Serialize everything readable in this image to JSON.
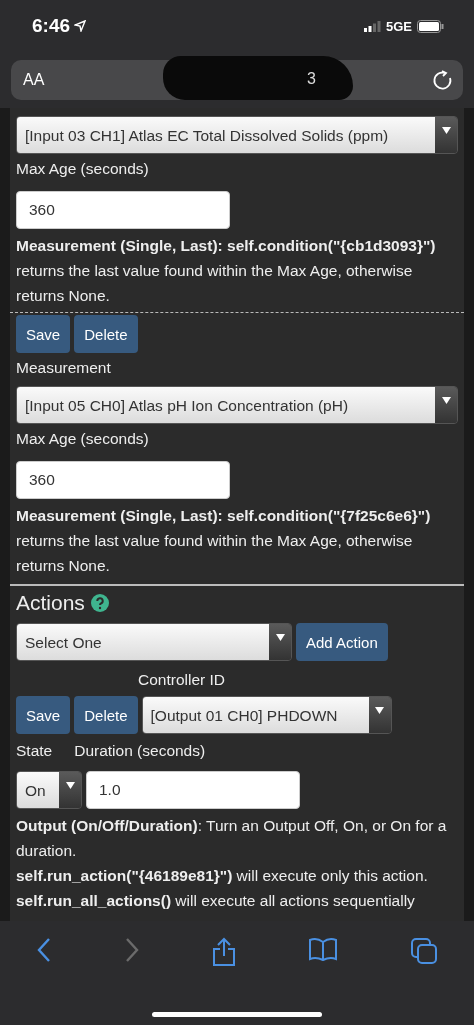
{
  "status_bar": {
    "time": "6:46",
    "network": "5GE"
  },
  "address_bar": {
    "text_size_button": "AA",
    "url_fragment": "3"
  },
  "conditions": [
    {
      "select": "[Input 03 CH1] Atlas EC Total Dissolved Solids (ppm)",
      "max_age_label": "Max Age (seconds)",
      "max_age": "360",
      "help": "**Measurement (Single, Last): self.condition(\"{cb1d3093}\")** returns the last value found within the Max Age, otherwise returns None.",
      "buttons": [
        "Save",
        "Delete"
      ]
    },
    {
      "label": "Measurement",
      "select": "[Input 05 CH0] Atlas pH Ion Concentration (pH)",
      "max_age_label": "Max Age (seconds)",
      "max_age": "360",
      "help": "**Measurement (Single, Last): self.condition(\"{7f25c6e6}\")** returns the last value found within the Max Age, otherwise returns None."
    }
  ],
  "actions": {
    "heading": "Actions",
    "add_select": "Select One",
    "add_button": "Add Action",
    "controller_id_label": "Controller ID",
    "buttons": [
      "Save",
      "Delete"
    ],
    "controller_select": "[Output 01 CH0] PHDOWN",
    "state_label": "State",
    "duration_label": "Duration (seconds)",
    "state": "On",
    "duration": "1.0",
    "description": [
      "**Output (On/Off/Duration)**: Turn an Output Off, On, or On for a duration.",
      "**self.run_action(\"{46189e81}\")** will execute only this action.",
      "**self.run_all_actions()** will execute all actions sequentially"
    ]
  },
  "toolbar": [
    {
      "kind": "back",
      "disabled": false
    },
    {
      "kind": "forward",
      "disabled": true
    },
    {
      "kind": "share",
      "disabled": false
    },
    {
      "kind": "bookmarks",
      "disabled": false
    },
    {
      "kind": "tabs",
      "disabled": false
    }
  ]
}
